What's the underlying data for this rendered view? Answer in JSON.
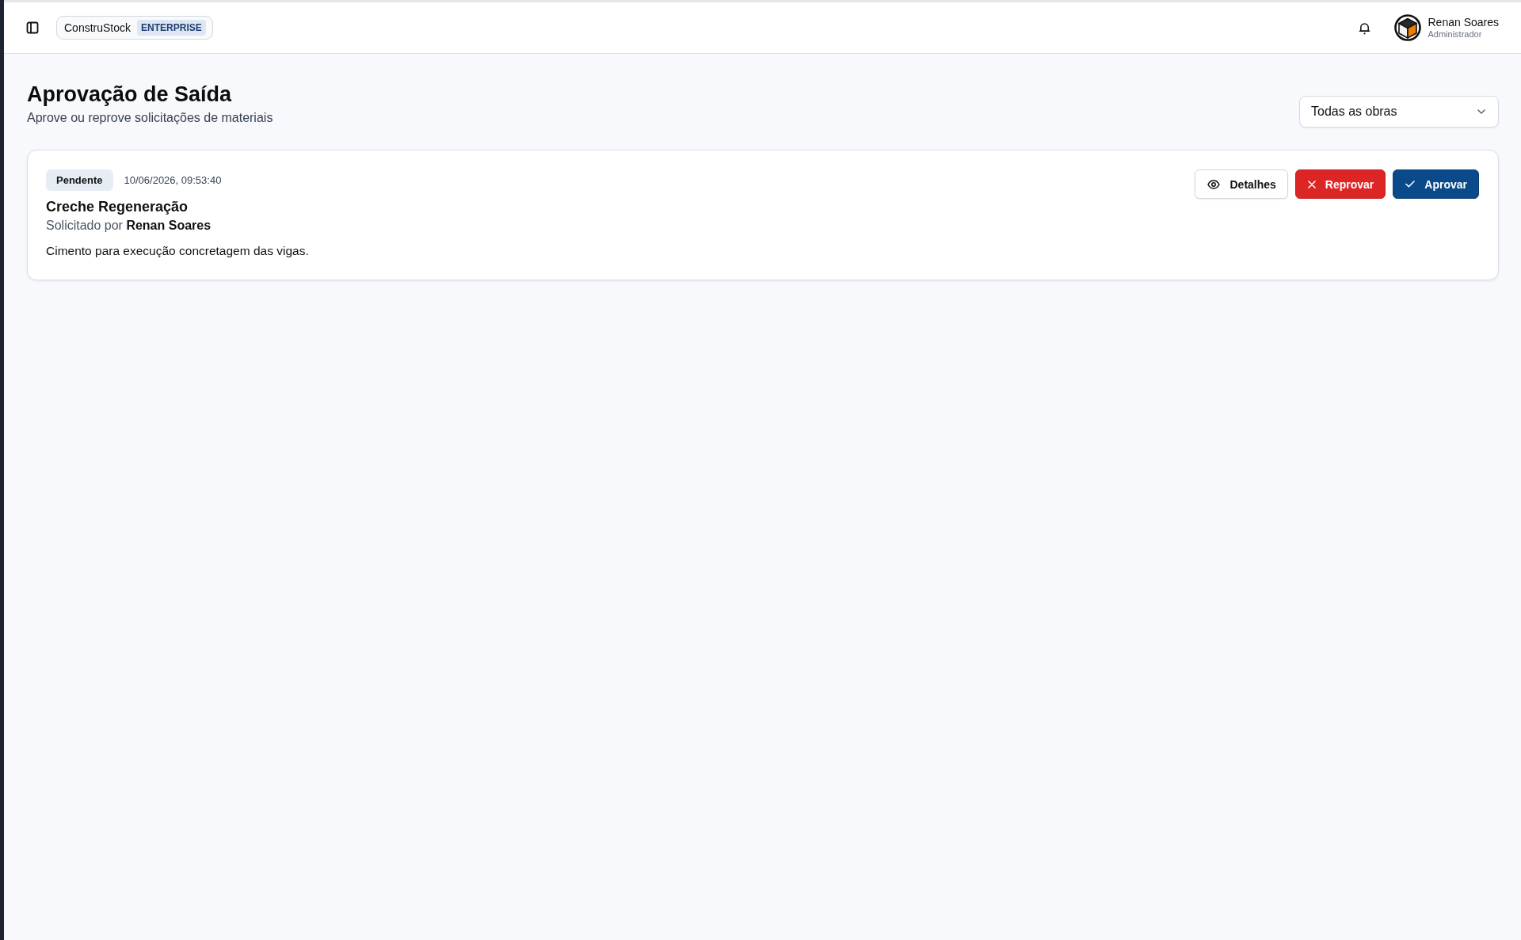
{
  "header": {
    "brand": "ConstruStock",
    "edition": "ENTERPRISE",
    "user": {
      "name": "Renan Soares",
      "role": "Administrador"
    }
  },
  "page": {
    "title": "Aprovação de Saída",
    "subtitle": "Aprove ou reprove solicitações de materiais"
  },
  "filter": {
    "value": "Todas as obras"
  },
  "requests": [
    {
      "status": "Pendente",
      "datetime": "10/06/2026, 09:53:40",
      "site": "Creche Regeneração",
      "requested_by": "Solicitado por **Renan Soares**",
      "description": "Cimento para execução concretagem das vigas.",
      "actions": [
        {
          "kind": "details",
          "label": "Detalhes"
        },
        {
          "kind": "reject",
          "label": "Reprovar"
        },
        {
          "kind": "approve",
          "label": "Aprovar"
        }
      ]
    }
  ]
}
